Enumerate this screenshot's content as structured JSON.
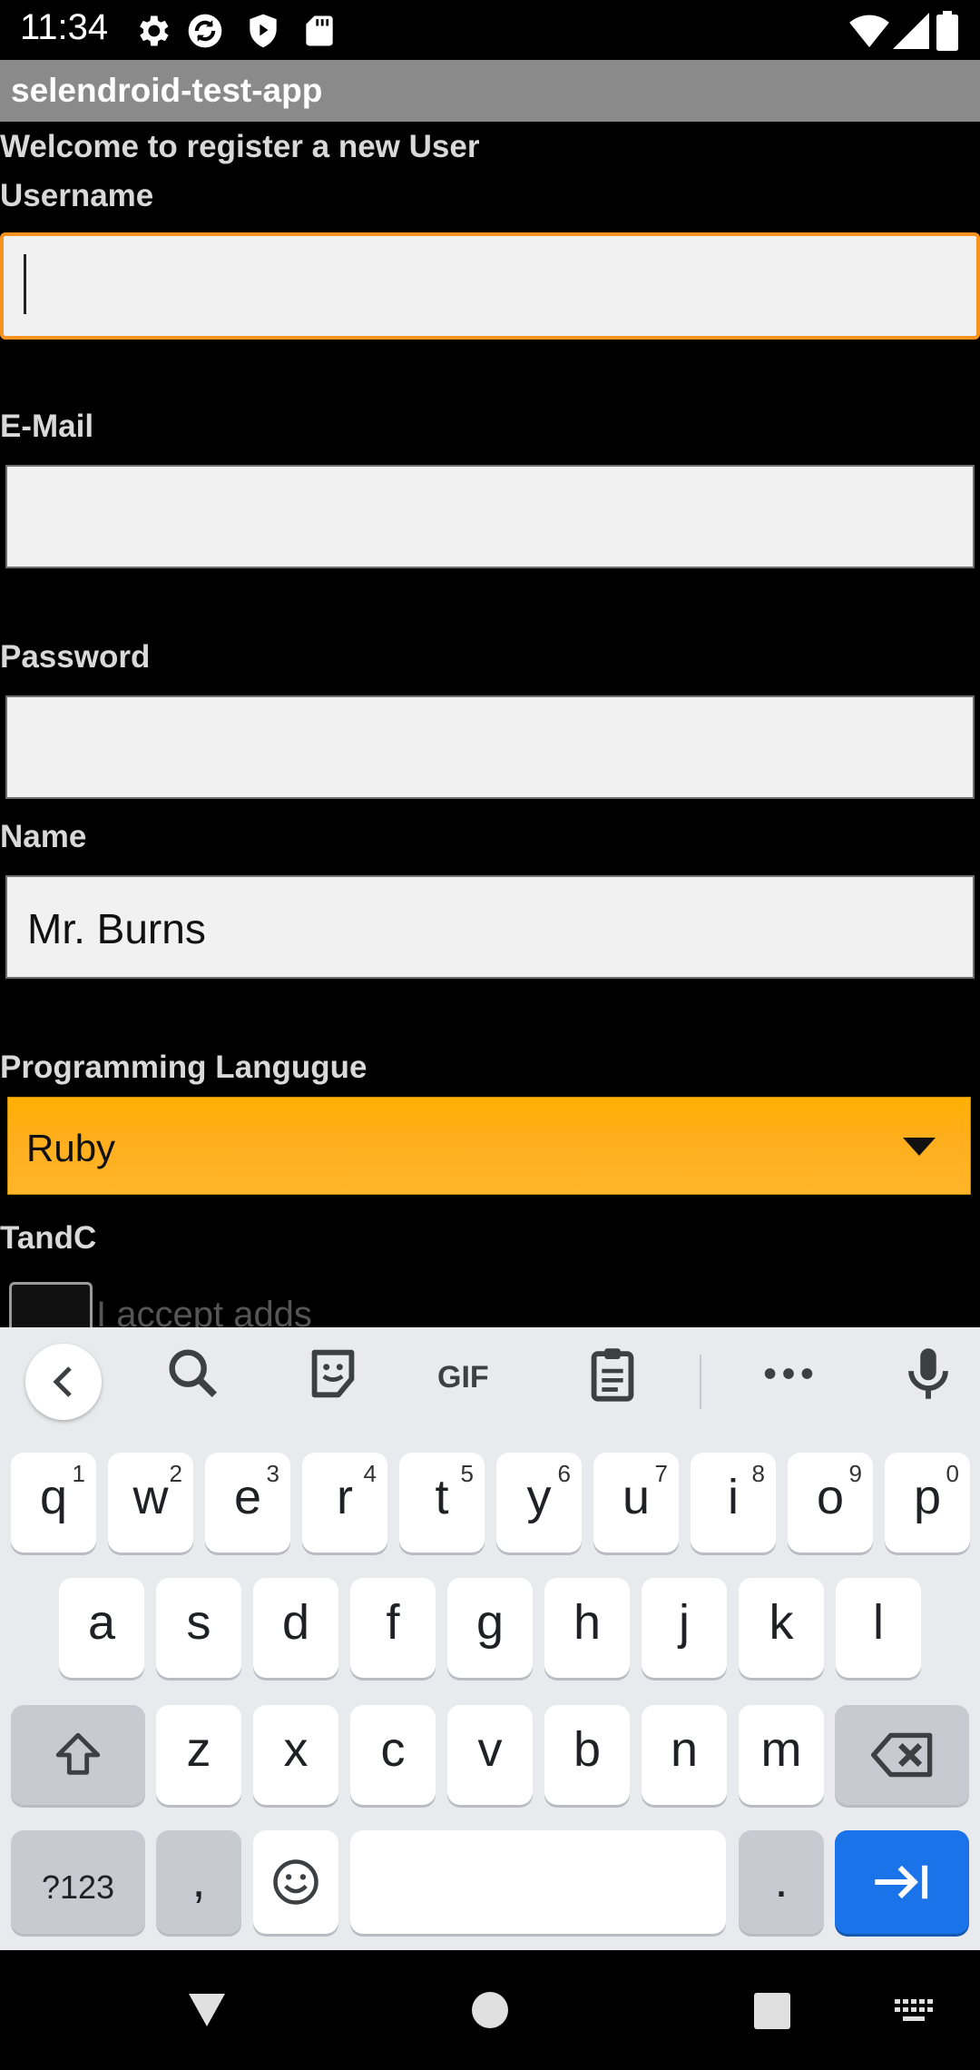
{
  "status_bar": {
    "time": "11:34",
    "left_icons": [
      "settings-icon",
      "sync-icon",
      "play-protect-icon",
      "sd-card-icon"
    ],
    "right_icons": [
      "wifi-icon",
      "signal-icon",
      "battery-icon"
    ]
  },
  "app": {
    "title": "selendroid-test-app"
  },
  "form": {
    "welcome": "Welcome to register a new User",
    "username_label": "Username",
    "username_value": "",
    "email_label": "E-Mail",
    "email_value": "",
    "password_label": "Password",
    "password_value": "",
    "name_label": "Name",
    "name_value": "Mr. Burns",
    "language_label": "Programming Langugue",
    "language_value": "Ruby",
    "tandc_label": "TandC",
    "accept_label": "I accept adds",
    "accept_checked": false
  },
  "keyboard": {
    "toolbar": [
      "back-chevron-icon",
      "search-icon",
      "sticker-icon",
      "gif-icon",
      "clipboard-icon",
      "more-icon",
      "mic-icon"
    ],
    "gif_label": "GIF",
    "row1": [
      {
        "k": "q",
        "h": "1"
      },
      {
        "k": "w",
        "h": "2"
      },
      {
        "k": "e",
        "h": "3"
      },
      {
        "k": "r",
        "h": "4"
      },
      {
        "k": "t",
        "h": "5"
      },
      {
        "k": "y",
        "h": "6"
      },
      {
        "k": "u",
        "h": "7"
      },
      {
        "k": "i",
        "h": "8"
      },
      {
        "k": "o",
        "h": "9"
      },
      {
        "k": "p",
        "h": "0"
      }
    ],
    "row2": [
      "a",
      "s",
      "d",
      "f",
      "g",
      "h",
      "j",
      "k",
      "l"
    ],
    "row3": [
      "z",
      "x",
      "c",
      "v",
      "b",
      "n",
      "m"
    ],
    "symbols_label": "?123",
    "comma_label": ",",
    "period_label": "."
  },
  "nav_bar": [
    "back-icon",
    "home-icon",
    "recents-icon",
    "keyboard-switch-icon"
  ]
}
